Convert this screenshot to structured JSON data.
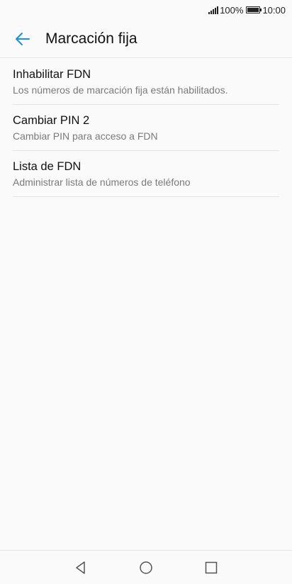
{
  "status_bar": {
    "battery_percent": "100%",
    "time": "10:00",
    "signal_icon": "signal-icon",
    "battery_icon": "battery-icon",
    "battery_level": 1.0
  },
  "header": {
    "title": "Marcación fija",
    "back_icon": "arrow-left-icon",
    "accent_color": "#1a8fe3"
  },
  "items": [
    {
      "title": "Inhabilitar FDN",
      "subtitle": "Los números de marcación fija están habilitados."
    },
    {
      "title": "Cambiar PIN 2",
      "subtitle": "Cambiar PIN para acceso a FDN"
    },
    {
      "title": "Lista de FDN",
      "subtitle": "Administrar lista de números de teléfono"
    }
  ],
  "nav_bar": {
    "back_icon": "triangle-back-icon",
    "home_icon": "circle-home-icon",
    "recents_icon": "square-recents-icon"
  }
}
